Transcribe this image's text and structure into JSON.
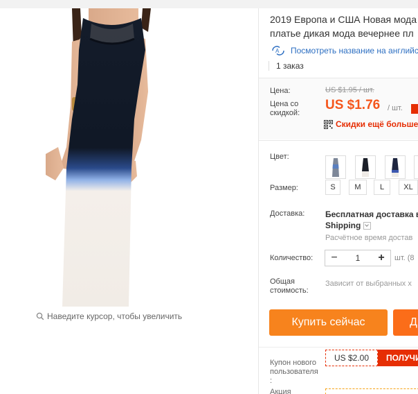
{
  "gallery": {
    "zoom_hint": "Наведите курсор, чтобы увеличить"
  },
  "product": {
    "title_line1": "2019 Европа и США Новая мода",
    "title_line2": "платье дикая мода вечернее пл",
    "translate_link": "Посмотреть название на английс",
    "orders": "1 заказ"
  },
  "pricing": {
    "price_label": "Цена:",
    "old_price": "US $1.95 / шт.",
    "discount_label_1": "Цена со",
    "discount_label_2": "скидкой:",
    "new_price": "US $1.76",
    "per_unit": "/ шт.",
    "more_discounts": "Скидки ещё больше в"
  },
  "options": {
    "color_label": "Цвет:",
    "colors": [
      "blue-white",
      "black-white",
      "navy-white",
      "grey"
    ],
    "size_label": "Размер:",
    "sizes": [
      "S",
      "M",
      "L",
      "XL"
    ]
  },
  "shipping": {
    "label": "Доставка:",
    "free_text": "Бесплатная доставка в",
    "method": "Shipping",
    "estimate": "Расчётное время достав"
  },
  "quantity": {
    "label": "Количество:",
    "minus": "−",
    "value": "1",
    "plus": "+",
    "available": "шт. (8"
  },
  "total": {
    "label_1": "Общая",
    "label_2": "стоимость:",
    "note": "Зависит от выбранных х"
  },
  "actions": {
    "buy_now": "Купить сейчас",
    "add_to_cart": "Д"
  },
  "coupon": {
    "label_1": "Купон нового",
    "label_2": "пользователя",
    "label_3": ":",
    "amount": "US $2.00",
    "get": "ПОЛУЧИ"
  },
  "promo": {
    "label": "Акция"
  },
  "colors": {
    "accent_orange": "#f5561c",
    "buy_button": "#f7831d",
    "coupon_red": "#e62e04",
    "link_blue": "#2d6fc2"
  }
}
